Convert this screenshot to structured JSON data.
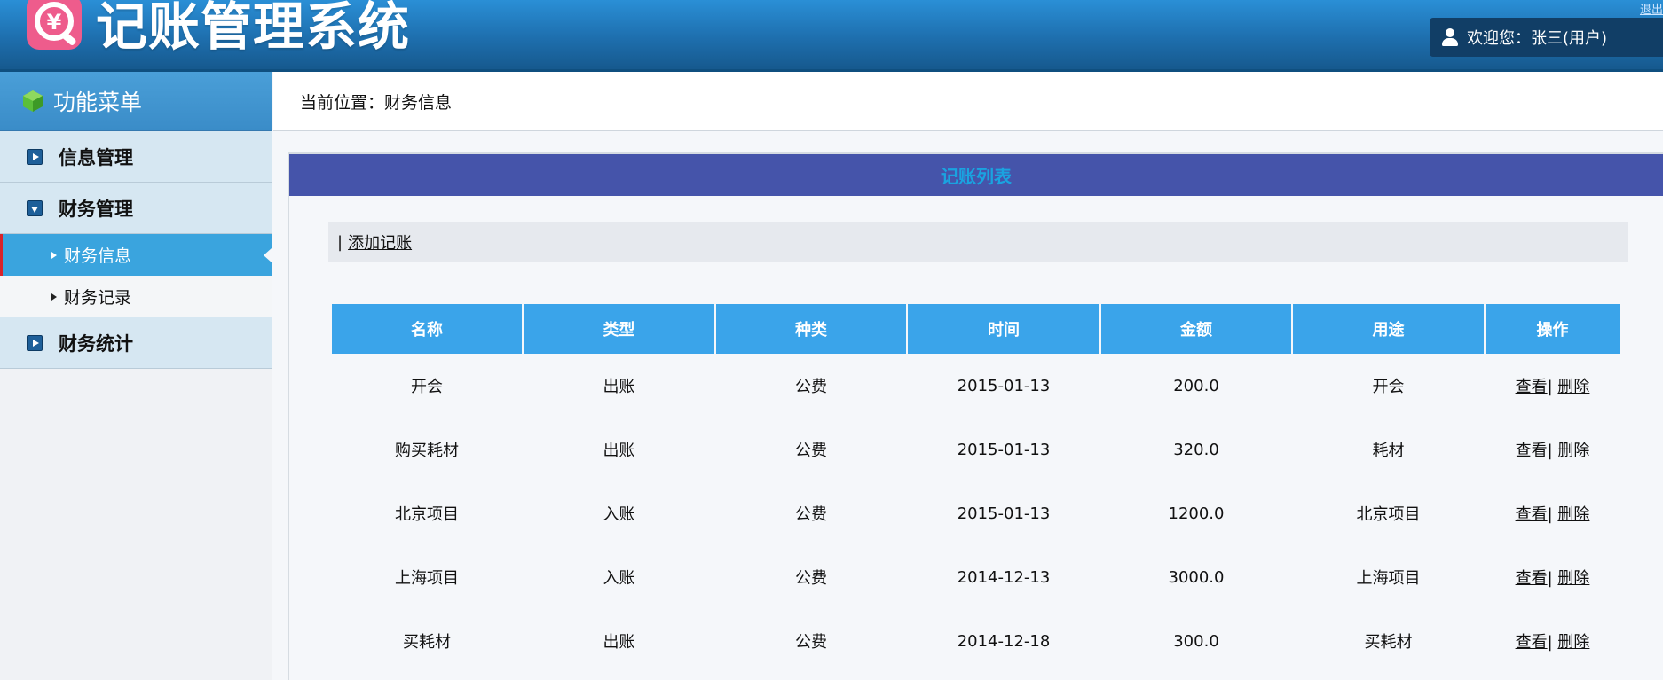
{
  "header": {
    "app_title": "记账管理系统",
    "top_link": "退出",
    "welcome_text": "欢迎您：张三(用户)"
  },
  "sidebar": {
    "title": "功能菜单",
    "groups": [
      {
        "label": "信息管理",
        "expanded": false
      },
      {
        "label": "财务管理",
        "expanded": true,
        "items": [
          {
            "label": "财务信息",
            "active": true
          },
          {
            "label": "财务记录",
            "active": false
          }
        ]
      },
      {
        "label": "财务统计",
        "expanded": false
      }
    ]
  },
  "breadcrumb": {
    "text": "当前位置：财务信息"
  },
  "panel": {
    "title": "记账列表",
    "toolbar_sep": "|",
    "add_link": "添加记账"
  },
  "table": {
    "columns": [
      "名称",
      "类型",
      "种类",
      "时间",
      "金额",
      "用途",
      "操作"
    ],
    "rows": [
      {
        "name": "开会",
        "type": "出账",
        "kind": "公费",
        "date": "2015-01-13",
        "amount": "200.0",
        "usage": "开会"
      },
      {
        "name": "购买耗材",
        "type": "出账",
        "kind": "公费",
        "date": "2015-01-13",
        "amount": "320.0",
        "usage": "耗材"
      },
      {
        "name": "北京项目",
        "type": "入账",
        "kind": "公费",
        "date": "2015-01-13",
        "amount": "1200.0",
        "usage": "北京项目"
      },
      {
        "name": "上海项目",
        "type": "入账",
        "kind": "公费",
        "date": "2014-12-13",
        "amount": "3000.0",
        "usage": "上海项目"
      },
      {
        "name": "买耗材",
        "type": "出账",
        "kind": "公费",
        "date": "2014-12-18",
        "amount": "300.0",
        "usage": "买耗材"
      }
    ],
    "action_view": "查看",
    "action_sep": "|",
    "action_delete": "删除"
  },
  "colors": {
    "header_blue": "#1e6fae",
    "panel_title_bg": "#4554aa",
    "panel_title_text": "#1aa3e0",
    "table_head": "#3aa4ea",
    "active_menu": "#3aa4de",
    "active_marker": "#d9232a"
  }
}
